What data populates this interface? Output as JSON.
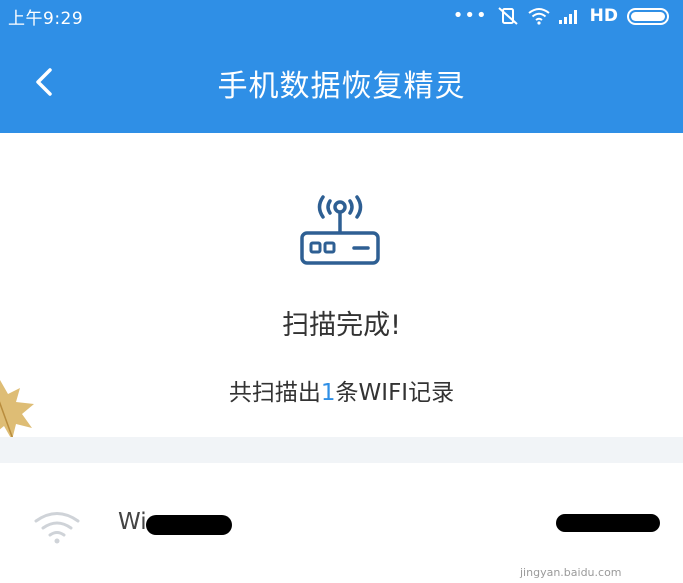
{
  "status_bar": {
    "time": "上午9:29",
    "dots": "•••",
    "network_label": "HD"
  },
  "app_bar": {
    "back_icon": "chevron-left-icon",
    "title": "手机数据恢复精灵"
  },
  "scan_result": {
    "icon": "wifi-router-icon",
    "status": "扫描完成!",
    "summary_prefix": "共扫描出",
    "count": "1",
    "summary_suffix": "条WIFI记录"
  },
  "wifi_records": [
    {
      "icon": "wifi-icon",
      "name": "Wi",
      "password": ""
    }
  ],
  "watermark": "jingyan.baidu.com",
  "colors": {
    "brand_blue": "#2f8fe6",
    "text_dark": "#333333",
    "divider": "#f1f4f7",
    "icon_blue": "#2e5f93"
  }
}
